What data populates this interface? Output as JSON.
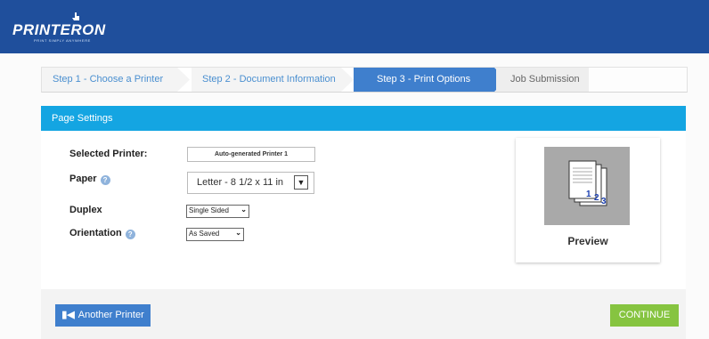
{
  "brand": {
    "name": "PRINTERON",
    "tagline": "PRINT SIMPLY ANYWHERE",
    "color": "#1f4f9c"
  },
  "steps": [
    {
      "label": "Step 1 - Choose a Printer",
      "state": "done"
    },
    {
      "label": "Step 2 - Document Information",
      "state": "done"
    },
    {
      "label": "Step 3 - Print Options",
      "state": "active"
    },
    {
      "label": "Job Submission",
      "state": "pending"
    }
  ],
  "panel": {
    "title": "Page Settings"
  },
  "form": {
    "selected_printer": {
      "label": "Selected Printer:",
      "value": "Auto-generated Printer 1"
    },
    "paper": {
      "label": "Paper",
      "value": "Letter - 8 1/2 x 11 in",
      "help_icon": "question-circle-icon"
    },
    "duplex": {
      "label": "Duplex",
      "value": "Single Sided"
    },
    "orientation": {
      "label": "Orientation",
      "value": "As Saved",
      "help_icon": "question-circle-icon"
    }
  },
  "preview": {
    "label": "Preview",
    "pages": [
      "1",
      "2",
      "3"
    ],
    "icon": "stacked-pages-icon"
  },
  "buttons": {
    "another_printer": "Another Printer",
    "another_printer_icon": "skip-back-icon",
    "continue": "CONTINUE"
  },
  "colors": {
    "header_bar": "#1f4f9c",
    "panel_header": "#14a5e2",
    "active_step": "#3f7fcd",
    "continue": "#86c440"
  }
}
